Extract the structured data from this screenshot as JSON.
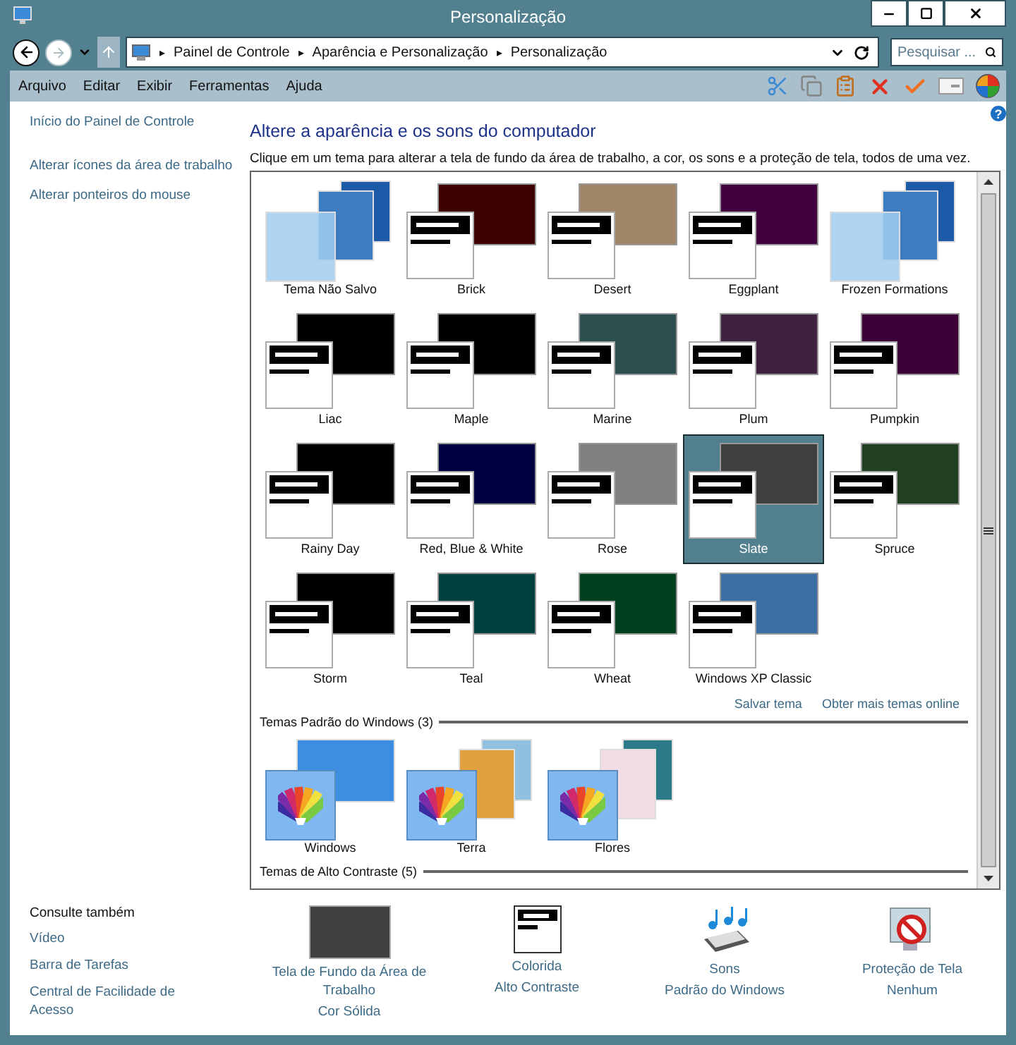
{
  "window": {
    "title": "Personalização"
  },
  "address_bar": {
    "breadcrumbs": [
      "Painel de Controle",
      "Aparência e Personalização",
      "Personalização"
    ],
    "separator": "▸"
  },
  "search": {
    "placeholder": "Pesquisar ..."
  },
  "menu": [
    "Arquivo",
    "Editar",
    "Exibir",
    "Ferramentas",
    "Ajuda"
  ],
  "sidebar": {
    "links": [
      "Início do Painel de Controle",
      "Alterar ícones da área de trabalho",
      "Alterar ponteiros do mouse"
    ],
    "see_also": {
      "title": "Consulte também",
      "links": [
        "Vídeo",
        "Barra de Tarefas",
        "Central de Facilidade de Acesso"
      ]
    }
  },
  "heading": "Altere a aparência e os sons do computador",
  "description": "Clique em um tema para alterar a tela de fundo da área de trabalho, a cor, os sons e a proteção de tela, todos de uma vez.",
  "my_themes": [
    {
      "name": "Tema Não Salvo",
      "kind": "photo",
      "selected": false
    },
    {
      "name": "Brick",
      "kind": "contrast",
      "color": "#3f0000",
      "selected": false
    },
    {
      "name": "Desert",
      "kind": "contrast",
      "color": "#a08668",
      "selected": false
    },
    {
      "name": "Eggplant",
      "kind": "contrast",
      "color": "#410040",
      "selected": false
    },
    {
      "name": "Frozen Formations",
      "kind": "photo",
      "selected": false
    },
    {
      "name": "Liac",
      "kind": "contrast",
      "color": "#000000",
      "selected": false
    },
    {
      "name": "Maple",
      "kind": "contrast",
      "color": "#000000",
      "selected": false
    },
    {
      "name": "Marine",
      "kind": "contrast",
      "color": "#2b4f4f",
      "selected": false
    },
    {
      "name": "Plum",
      "kind": "contrast",
      "color": "#3f2240",
      "selected": false
    },
    {
      "name": "Pumpkin",
      "kind": "contrast",
      "color": "#3c0038",
      "selected": false
    },
    {
      "name": "Rainy Day",
      "kind": "contrast",
      "color": "#000000",
      "selected": false
    },
    {
      "name": "Red, Blue & White",
      "kind": "contrast",
      "color": "#000040",
      "selected": false
    },
    {
      "name": "Rose",
      "kind": "contrast",
      "color": "#808080",
      "selected": false
    },
    {
      "name": "Slate",
      "kind": "contrast",
      "color": "#404040",
      "selected": true
    },
    {
      "name": "Spruce",
      "kind": "contrast",
      "color": "#213f21",
      "selected": false
    },
    {
      "name": "Storm",
      "kind": "contrast",
      "color": "#000000",
      "selected": false
    },
    {
      "name": "Teal",
      "kind": "contrast",
      "color": "#004040",
      "selected": false
    },
    {
      "name": "Wheat",
      "kind": "contrast",
      "color": "#003f1e",
      "selected": false
    },
    {
      "name": "Windows XP Classic",
      "kind": "contrast",
      "color": "#3a6ea5",
      "selected": false
    }
  ],
  "theme_links": [
    "Salvar tema",
    "Obter mais temas online"
  ],
  "sections": [
    {
      "title": "Temas Padrão do Windows (3)",
      "themes": [
        {
          "name": "Windows",
          "kind": "flower",
          "selected": false
        },
        {
          "name": "Terra",
          "kind": "landscape",
          "selected": false
        },
        {
          "name": "Flores",
          "kind": "bloom",
          "selected": false
        }
      ]
    },
    {
      "title": "Temas de Alto Contraste (5)"
    }
  ],
  "help": "?",
  "settings": [
    {
      "kind": "wallpaper",
      "title": "Tela de Fundo da Área de Trabalho",
      "value": "Cor Sólida"
    },
    {
      "kind": "color",
      "title": "Colorida",
      "value": "Alto Contraste"
    },
    {
      "kind": "sounds",
      "title": "Sons",
      "value": "Padrão do Windows"
    },
    {
      "kind": "screensaver",
      "title": "Proteção de Tela",
      "value": "Nenhum"
    }
  ]
}
